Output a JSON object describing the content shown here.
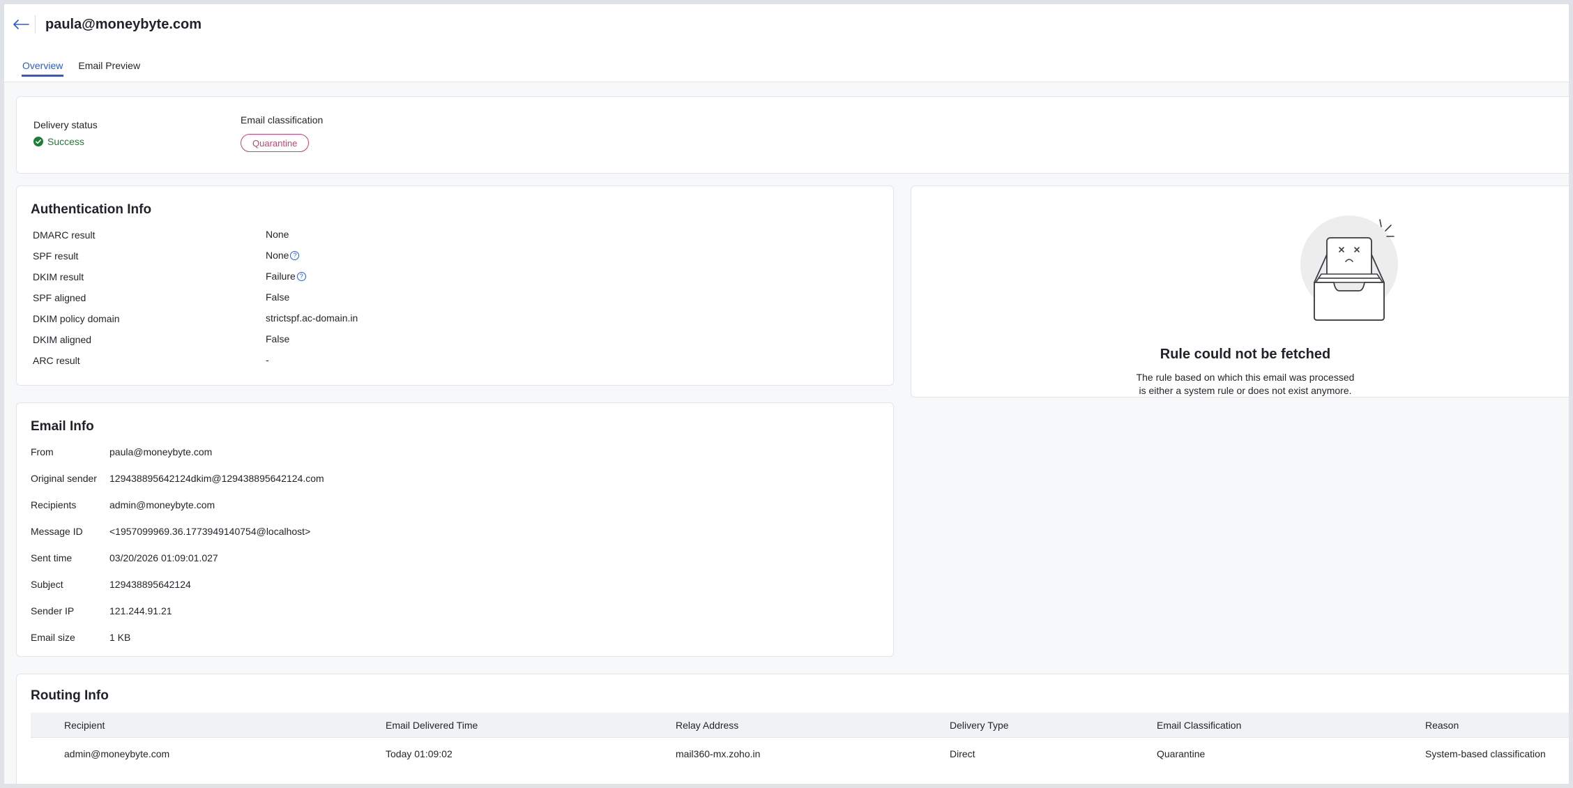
{
  "header": {
    "title": "paula@moneybyte.com"
  },
  "tabs": [
    {
      "label": "Overview",
      "active": true
    },
    {
      "label": "Email Preview",
      "active": false
    }
  ],
  "delivery": {
    "status_label": "Delivery status",
    "status_value": "Success",
    "classification_label": "Email classification",
    "classification_value": "Quarantine",
    "classification_color": "#d13e6f",
    "success_color": "#1e7e34"
  },
  "auth": {
    "title": "Authentication Info",
    "rows": [
      {
        "key": "DMARC result",
        "value": "None"
      },
      {
        "key": "SPF result",
        "value": "None"
      },
      {
        "key": "DKIM result",
        "value": "Failure"
      },
      {
        "key": "SPF aligned",
        "value": "False"
      },
      {
        "key": "DKIM policy domain",
        "value": "strictspf.ac-domain.in"
      },
      {
        "key": "DKIM aligned",
        "value": "False"
      },
      {
        "key": "ARC result",
        "value": "-"
      }
    ]
  },
  "rule": {
    "title": "Rule could not be fetched",
    "desc_line1": "The rule based on which this email was processed",
    "desc_line2": "is either a system rule or does not exist anymore."
  },
  "email": {
    "title": "Email Info",
    "rows": [
      {
        "key": "From",
        "value": "paula@moneybyte.com"
      },
      {
        "key": "Original sender",
        "value": "129438895642124dkim@129438895642124.com"
      },
      {
        "key": "Recipients",
        "value": "admin@moneybyte.com"
      },
      {
        "key": "Message ID",
        "value": "<1957099969.36.1773949140754@localhost>"
      },
      {
        "key": "Sent time",
        "value": "03/20/2026 01:09:01.027"
      },
      {
        "key": "Subject",
        "value": "129438895642124"
      },
      {
        "key": "Sender IP",
        "value": "121.244.91.21"
      },
      {
        "key": "Email size",
        "value": "1 KB"
      }
    ]
  },
  "routing": {
    "title": "Routing Info",
    "columns": [
      "Recipient",
      "Email Delivered Time",
      "Relay Address",
      "Delivery Type",
      "Email Classification",
      "Reason"
    ],
    "rows": [
      [
        "admin@moneybyte.com",
        "Today 01:09:02",
        "mail360-mx.zoho.in",
        "Direct",
        "Quarantine",
        "System-based classification"
      ]
    ]
  },
  "colors": {
    "accent": "#2a5bd7"
  }
}
